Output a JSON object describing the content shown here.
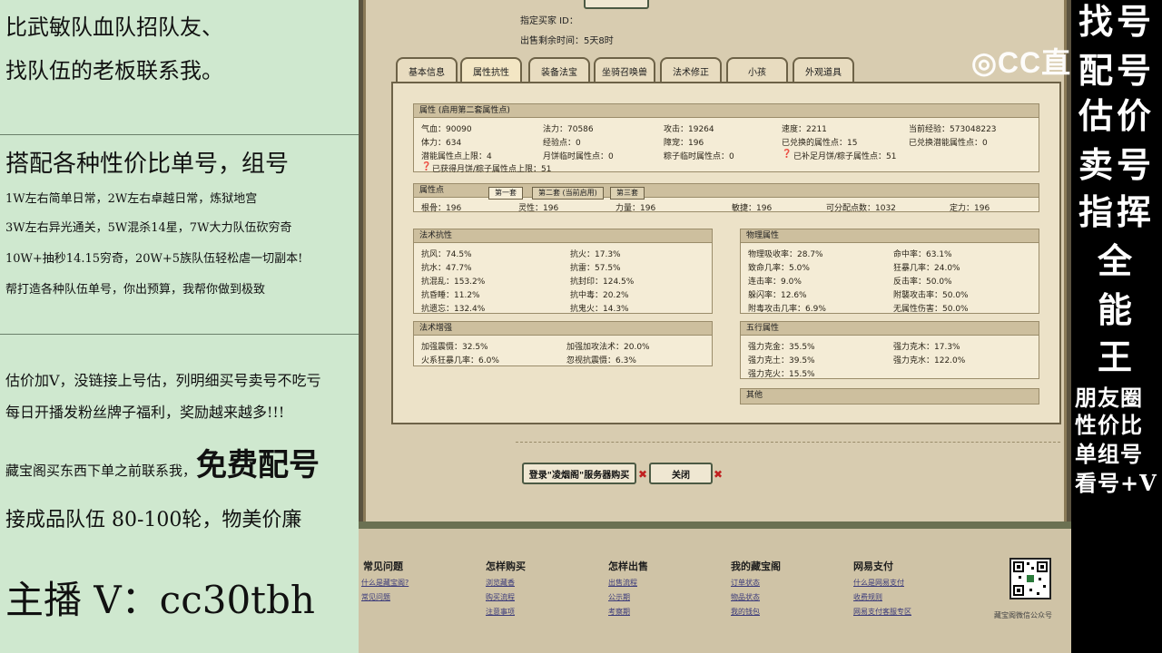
{
  "left": {
    "l1": "比武敏队血队招队友、",
    "l2": "找队伍的老板联系我。",
    "l3": "搭配各种性价比单号，组号",
    "l4": "1W左右简单日常，2W左右卓越日常，炼狱地宫",
    "l5": "3W左右异光通关，5W混杀14星，7W大力队伍砍穷奇",
    "l6": "10W+抽秒14.15穷奇，20W+5族队伍轻松虐一切副本!",
    "l7": "帮打造各种队伍单号，你出预算，我帮你做到极致",
    "l8": "估价加V，没链接上号估，列明细买号卖号不吃亏",
    "l9": "每日开播发粉丝牌子福利，奖励越来越多!!!",
    "l10a": "藏宝阁买东西下单之前联系我，",
    "l10b": "免费配号",
    "l11": "接成品队伍 80-100轮，物美价廉",
    "l12": "主播 V：cc30tbh"
  },
  "right": {
    "big": [
      "找号",
      "配号",
      "估价",
      "卖号",
      "指挥",
      "全",
      "能",
      "王"
    ],
    "small": [
      "朋友圈",
      "性价比",
      "单组号",
      "看号+V"
    ]
  },
  "watermark": "CC直播",
  "top": {
    "seller_label": "指定买家 ID：",
    "remain_label": "出售剩余时间：",
    "remain_value": "5天8时"
  },
  "tabs": [
    "基本信息",
    "属性抗性",
    "装备法宝",
    "坐骑召唤兽",
    "法术修正",
    "小孩",
    "外观道具"
  ],
  "attr": {
    "title": "属性 (启用第二套属性点)",
    "r1": [
      "气血：90090",
      "法力：70586",
      "攻击：19264",
      "速度：2211",
      "当前经验：573048223"
    ],
    "r2": [
      "体力：634",
      "经验点：0",
      "障宠：196",
      "已兑换的属性点：15",
      "已兑换潜能属性点：0"
    ],
    "r3": [
      "潜能属性点上限：4",
      "月饼临时属性点：0",
      "粽子临时属性点：0",
      "已补足月饼/粽子属性点：51"
    ],
    "r4": "已获得月饼/粽子属性点上限：51"
  },
  "points": {
    "title": "属性点",
    "subtabs": [
      "第一套",
      "第二套 (当前启用)",
      "第三套"
    ],
    "row": [
      "根骨：196",
      "灵性：196",
      "力量：196",
      "敏捷：196",
      "可分配点数：1032",
      "定力：196"
    ]
  },
  "resist": {
    "title": "法术抗性",
    "items": [
      "抗风：74.5%",
      "抗火：17.3%",
      "抗水：47.7%",
      "抗雷：57.5%",
      "抗混乱：153.2%",
      "抗封印：124.5%",
      "抗昏睡：11.2%",
      "抗中毒：20.2%",
      "抗遗忘：132.4%",
      "抗鬼火：14.3%"
    ]
  },
  "phys": {
    "title": "物理属性",
    "items": [
      "物理吸收率：28.7%",
      "命中率：63.1%",
      "致命几率：5.0%",
      "狂暴几率：24.0%",
      "连击率：9.0%",
      "反击率：50.0%",
      "躲闪率：12.6%",
      "附襲攻击率：50.0%",
      "附毒攻击几率：6.9%",
      "无属性伤害：50.0%"
    ]
  },
  "boost": {
    "title": "法术增强",
    "items": [
      "加强震慑：32.5%",
      "加强加攻法术：20.0%",
      "火系狂暴几率：6.0%",
      "忽视抗震慑：6.3%"
    ]
  },
  "five": {
    "title": "五行属性",
    "items": [
      "强力克金：35.5%",
      "强力克木：17.3%",
      "强力克土：39.5%",
      "强力克水：122.0%",
      "强力克火：15.5%"
    ]
  },
  "other": {
    "title": "其他"
  },
  "buttons": {
    "login": "登录\"凌烟阁\"服务器购买",
    "close": "关闭"
  },
  "footer": {
    "cols": [
      {
        "h": "常见问题",
        "links": [
          "什么是藏宝阁?",
          "常见问题"
        ]
      },
      {
        "h": "怎样购买",
        "links": [
          "浏览藏香",
          "购买流程",
          "注意事项"
        ]
      },
      {
        "h": "怎样出售",
        "links": [
          "出售流程",
          "公示期",
          "考察期"
        ]
      },
      {
        "h": "我的藏宝阁",
        "links": [
          "订单状态",
          "物品状态",
          "我的钱包"
        ]
      },
      {
        "h": "网易支付",
        "links": [
          "什么是网易支付",
          "收费规则",
          "网易支付客服专区"
        ]
      }
    ],
    "qr_caption": "藏宝阁微信公众号"
  }
}
